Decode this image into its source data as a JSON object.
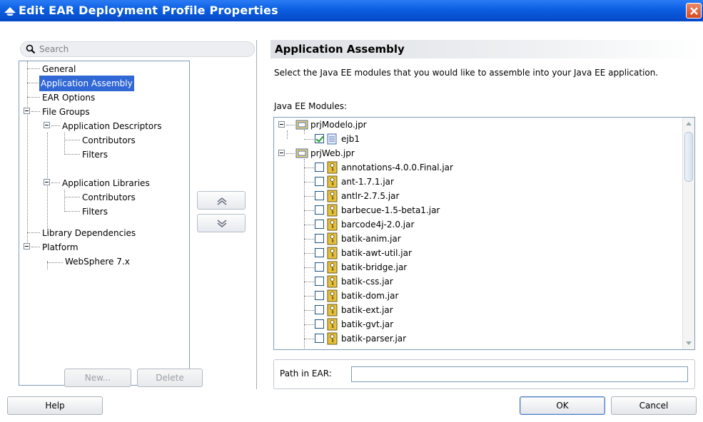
{
  "window": {
    "title": "Edit EAR Deployment Profile Properties"
  },
  "search": {
    "placeholder": "Search"
  },
  "nav": {
    "items": [
      {
        "label": "General"
      },
      {
        "label": "Application Assembly",
        "selected": true
      },
      {
        "label": "EAR Options"
      },
      {
        "label": "File Groups"
      },
      {
        "label": "Application Descriptors"
      },
      {
        "label": "Contributors"
      },
      {
        "label": "Filters"
      },
      {
        "label": "Application Libraries"
      },
      {
        "label": "Contributors"
      },
      {
        "label": "Filters"
      },
      {
        "label": "Library Dependencies"
      },
      {
        "label": "Platform"
      },
      {
        "label": "WebSphere 7.x"
      }
    ],
    "new_label": "New...",
    "delete_label": "Delete"
  },
  "panel": {
    "title": "Application Assembly",
    "description": "Select the Java EE modules that you would like to assemble into your Java EE application.",
    "modules_label": "Java EE Modules:",
    "modules": [
      {
        "label": "prjModelo.jpr",
        "kind": "project"
      },
      {
        "label": "ejb1",
        "kind": "ejb",
        "checked": true
      },
      {
        "label": "prjWeb.jpr",
        "kind": "project"
      },
      {
        "label": "annotations-4.0.0.Final.jar",
        "kind": "jar",
        "checked": false
      },
      {
        "label": "ant-1.7.1.jar",
        "kind": "jar",
        "checked": false
      },
      {
        "label": "antlr-2.7.5.jar",
        "kind": "jar",
        "checked": false
      },
      {
        "label": "barbecue-1.5-beta1.jar",
        "kind": "jar",
        "checked": false
      },
      {
        "label": "barcode4j-2.0.jar",
        "kind": "jar",
        "checked": false
      },
      {
        "label": "batik-anim.jar",
        "kind": "jar",
        "checked": false
      },
      {
        "label": "batik-awt-util.jar",
        "kind": "jar",
        "checked": false
      },
      {
        "label": "batik-bridge.jar",
        "kind": "jar",
        "checked": false
      },
      {
        "label": "batik-css.jar",
        "kind": "jar",
        "checked": false
      },
      {
        "label": "batik-dom.jar",
        "kind": "jar",
        "checked": false
      },
      {
        "label": "batik-ext.jar",
        "kind": "jar",
        "checked": false
      },
      {
        "label": "batik-gvt.jar",
        "kind": "jar",
        "checked": false
      },
      {
        "label": "batik-parser.jar",
        "kind": "jar",
        "checked": false
      }
    ],
    "path_label": "Path in EAR:",
    "path_value": ""
  },
  "footer": {
    "help_label": "Help",
    "ok_label": "OK",
    "cancel_label": "Cancel"
  },
  "colors": {
    "titlebar": "#0a5fe0",
    "selection": "#3168d5",
    "jar_icon": "#e8c13c",
    "folder_icon": "#f2d16a"
  }
}
